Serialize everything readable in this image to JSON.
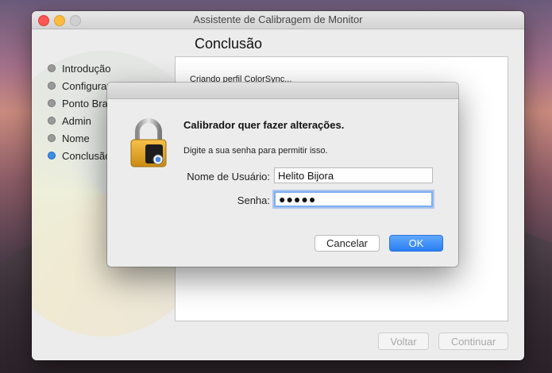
{
  "window": {
    "title": "Assistente de Calibragem de Monitor"
  },
  "page": {
    "heading": "Conclusão",
    "status_text": "Criando perfil ColorSync..."
  },
  "sidebar": {
    "steps": [
      {
        "label": "Introdução",
        "state": "done"
      },
      {
        "label": "Configurar",
        "state": "done"
      },
      {
        "label": "Ponto Bra",
        "state": "done"
      },
      {
        "label": "Admin",
        "state": "done"
      },
      {
        "label": "Nome",
        "state": "done"
      },
      {
        "label": "Conclusão",
        "state": "current"
      }
    ]
  },
  "footer": {
    "back_label": "Voltar",
    "continue_label": "Continuar"
  },
  "dialog": {
    "title": "Calibrador quer fazer alterações.",
    "message": "Digite a sua senha para permitir isso.",
    "username_label": "Nome de Usuário:",
    "username_value": "Helito Bijora",
    "password_label": "Senha:",
    "password_value": "●●●●●",
    "cancel_label": "Cancelar",
    "ok_label": "OK",
    "icon": "lock-icon"
  },
  "colors": {
    "accent": "#2a7ff2",
    "current_step": "#3a8ee6"
  }
}
